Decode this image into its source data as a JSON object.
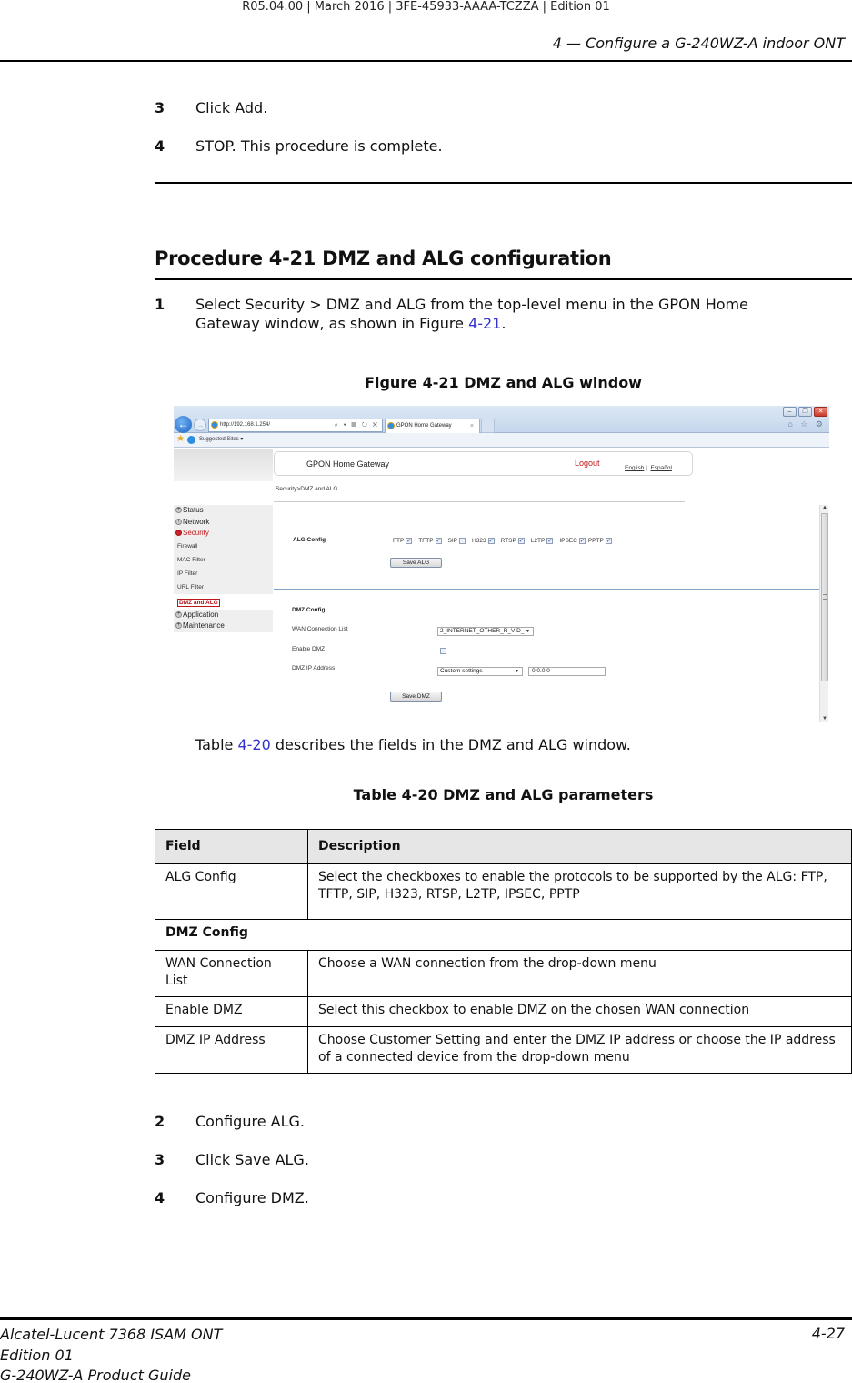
{
  "header": {
    "doc_id": "R05.04.00 | March 2016 | 3FE-45933-AAAA-TCZZA | Edition 01",
    "chapter": "4 — Configure a G-240WZ-A indoor ONT"
  },
  "prev_steps": [
    {
      "num": "3",
      "text": "Click Add."
    },
    {
      "num": "4",
      "text": "STOP. This procedure is complete."
    }
  ],
  "procedure": {
    "title": "Procedure 4-21  DMZ and ALG configuration",
    "step1": {
      "num": "1",
      "text_before": "Select Security > DMZ and ALG from the top-level menu in the GPON Home Gateway window, as shown in Figure ",
      "link": "4-21",
      "text_after": "."
    },
    "figure_title": "Figure 4-21  DMZ and ALG window",
    "table_ref": {
      "before": "Table ",
      "link": "4-20",
      "after": " describes the fields in the DMZ and ALG window."
    },
    "table_title": "Table 4-20 DMZ and ALG parameters",
    "later_steps": [
      {
        "num": "2",
        "text": "Configure ALG."
      },
      {
        "num": "3",
        "text": "Click Save ALG."
      },
      {
        "num": "4",
        "text": "Configure DMZ."
      }
    ]
  },
  "screenshot": {
    "browser": {
      "url": "http://192.168.1.254/",
      "addr_tools": "⌕ ▾ ▤ ↻ ✕",
      "tab_title": "GPON Home Gateway",
      "tab_close": "×",
      "favorites_link": "Suggested Sites ▾",
      "win_buttons": [
        "–",
        "❐",
        "✕"
      ],
      "right_icons": "⌂ ☆ ⚙"
    },
    "app": {
      "title": "GPON Home Gateway",
      "logout": "Logout",
      "lang_english": "English",
      "lang_sep": "|",
      "lang_spanish": "Español",
      "breadcrumb": "Security>DMZ and ALG"
    },
    "nav": {
      "top": [
        {
          "label": "Status",
          "bullet": "+"
        },
        {
          "label": "Network",
          "bullet": "+"
        },
        {
          "label": "Security",
          "bullet": "−"
        }
      ],
      "sub": [
        "Firewall",
        "MAC Filter",
        "IP Filter",
        "URL Filter"
      ],
      "current": "DMZ and ALG",
      "bottom": [
        {
          "label": "Application",
          "bullet": "+"
        },
        {
          "label": "Maintenance",
          "bullet": "+"
        }
      ]
    },
    "alg": {
      "label": "ALG Config",
      "protocols": [
        {
          "name": "FTP",
          "checked": true
        },
        {
          "name": "TFTP",
          "checked": true
        },
        {
          "name": "SIP",
          "checked": false
        },
        {
          "name": "H323",
          "checked": true
        },
        {
          "name": "RTSP",
          "checked": true
        },
        {
          "name": "L2TP",
          "checked": true
        },
        {
          "name": "IPSEC",
          "checked": true
        },
        {
          "name": "PPTP",
          "checked": true
        }
      ],
      "save_label": "Save ALG"
    },
    "dmz": {
      "label": "DMZ Config",
      "wan_label": "WAN Connection List",
      "wan_value": "2_INTERNET_OTHER_R_VID_",
      "enable_label": "Enable DMZ",
      "enable_checked": false,
      "ip_label": "DMZ IP Address",
      "ip_mode": "Custom settings",
      "ip_value": "0.0.0.0",
      "save_label": "Save DMZ"
    }
  },
  "table": {
    "headers": [
      "Field",
      "Description"
    ],
    "rows": [
      {
        "field": "ALG Config",
        "desc": "Select the checkboxes to enable the protocols to be supported by the ALG: FTP, TFTP, SIP, H323, RTSP, L2TP, IPSEC, PPTP"
      },
      {
        "section": "DMZ Config"
      },
      {
        "field": "WAN Connection List",
        "desc": "Choose a WAN connection from the drop-down menu"
      },
      {
        "field": "Enable DMZ",
        "desc": "Select this checkbox to enable DMZ on the chosen WAN connection"
      },
      {
        "field": "DMZ IP Address",
        "desc": "Choose Customer Setting and enter the DMZ IP address or choose the IP address of a connected device from the drop-down menu"
      }
    ]
  },
  "footer": {
    "product": "Alcatel-Lucent 7368 ISAM ONT",
    "edition": "Edition 01",
    "guide": "G-240WZ-A Product Guide",
    "page": "4-27"
  }
}
